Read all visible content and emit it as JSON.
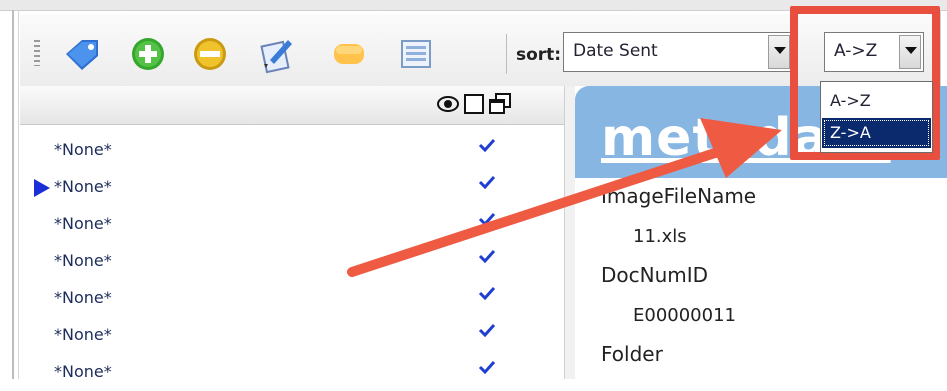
{
  "toolbar": {
    "icons": [
      "tag-icon",
      "add-icon",
      "remove-icon",
      "edit-document-icon",
      "label-icon",
      "list-view-icon"
    ],
    "sort_label": "sort:",
    "sort_field_value": "Date Sent",
    "sort_order_value": "A->Z",
    "sort_order_options": [
      {
        "label": "A->Z",
        "selected": false
      },
      {
        "label": "Z->A",
        "selected": true
      }
    ]
  },
  "left_pane": {
    "header_icons": [
      "eye-icon",
      "square-icon",
      "windows-icon"
    ],
    "rows": [
      {
        "label": "*None*",
        "checked": true,
        "current": false
      },
      {
        "label": "*None*",
        "checked": true,
        "current": true
      },
      {
        "label": "*None*",
        "checked": true,
        "current": false
      },
      {
        "label": "*None*",
        "checked": true,
        "current": false
      },
      {
        "label": "*None*",
        "checked": true,
        "current": false
      },
      {
        "label": "*None*",
        "checked": true,
        "current": false
      },
      {
        "label": "*None*",
        "checked": true,
        "current": false
      }
    ]
  },
  "metadata": {
    "title": "metadata",
    "fields": [
      {
        "label": "ImageFileName",
        "value": "11.xls"
      },
      {
        "label": "DocNumID",
        "value": "E00000011"
      },
      {
        "label": "Folder",
        "value": ""
      }
    ]
  },
  "colors": {
    "highlight": "#e94f3f",
    "arrow": "#ef5a43",
    "metadata_header": "#87b6e2",
    "selection": "#0b2a6e",
    "pointer": "#1b2fd8",
    "check": "#1f3fd0"
  }
}
